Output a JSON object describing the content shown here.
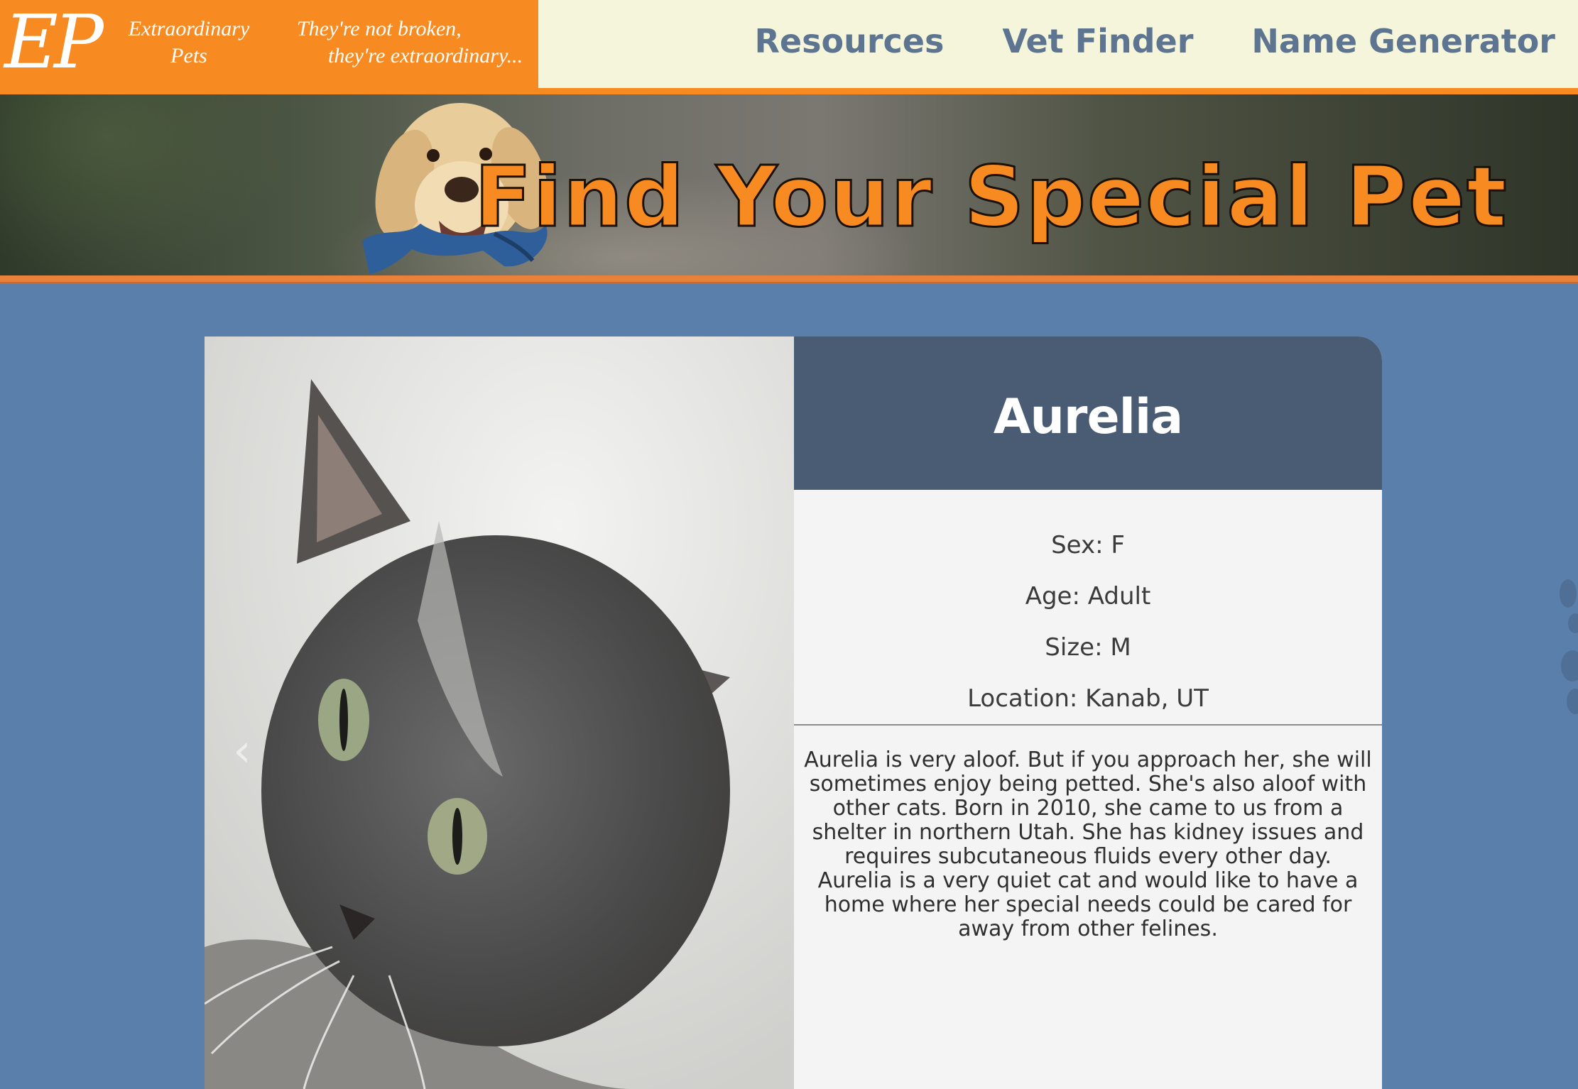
{
  "brand": {
    "logo_letters": "EP",
    "name_line1": "Extraordinary",
    "name_line2": "Pets",
    "tagline_line1": "They're not broken,",
    "tagline_line2": "they're extraordinary..."
  },
  "nav": {
    "items": [
      {
        "label": "Resources"
      },
      {
        "label": "Vet Finder"
      },
      {
        "label": "Name Generator"
      }
    ]
  },
  "hero": {
    "title": "Find Your Special Pet"
  },
  "pet": {
    "name": "Aurelia",
    "sex": "Sex: F",
    "age": "Age: Adult",
    "size": "Size: M",
    "location": "Location: Kanab, UT",
    "description": "Aurelia is very aloof. But if you approach her, she will sometimes enjoy being petted. She's also aloof with other cats. Born in 2010, she came to us from a shelter in northern Utah. She has kidney issues and requires subcutaneous fluids every other day. Aurelia is a very quiet cat and would like to have a home where her special needs could be cared for away from other felines."
  },
  "carousel": {
    "prev_icon": "chevron-left-icon",
    "next_icon": "chevron-right-icon"
  },
  "colors": {
    "brand_orange": "#f78b22",
    "nav_text": "#5d7590",
    "topbar_bg": "#f5f5dc",
    "page_bg": "#5a7fab",
    "card_header": "#4a5b74",
    "card_body": "#f4f4f4"
  }
}
